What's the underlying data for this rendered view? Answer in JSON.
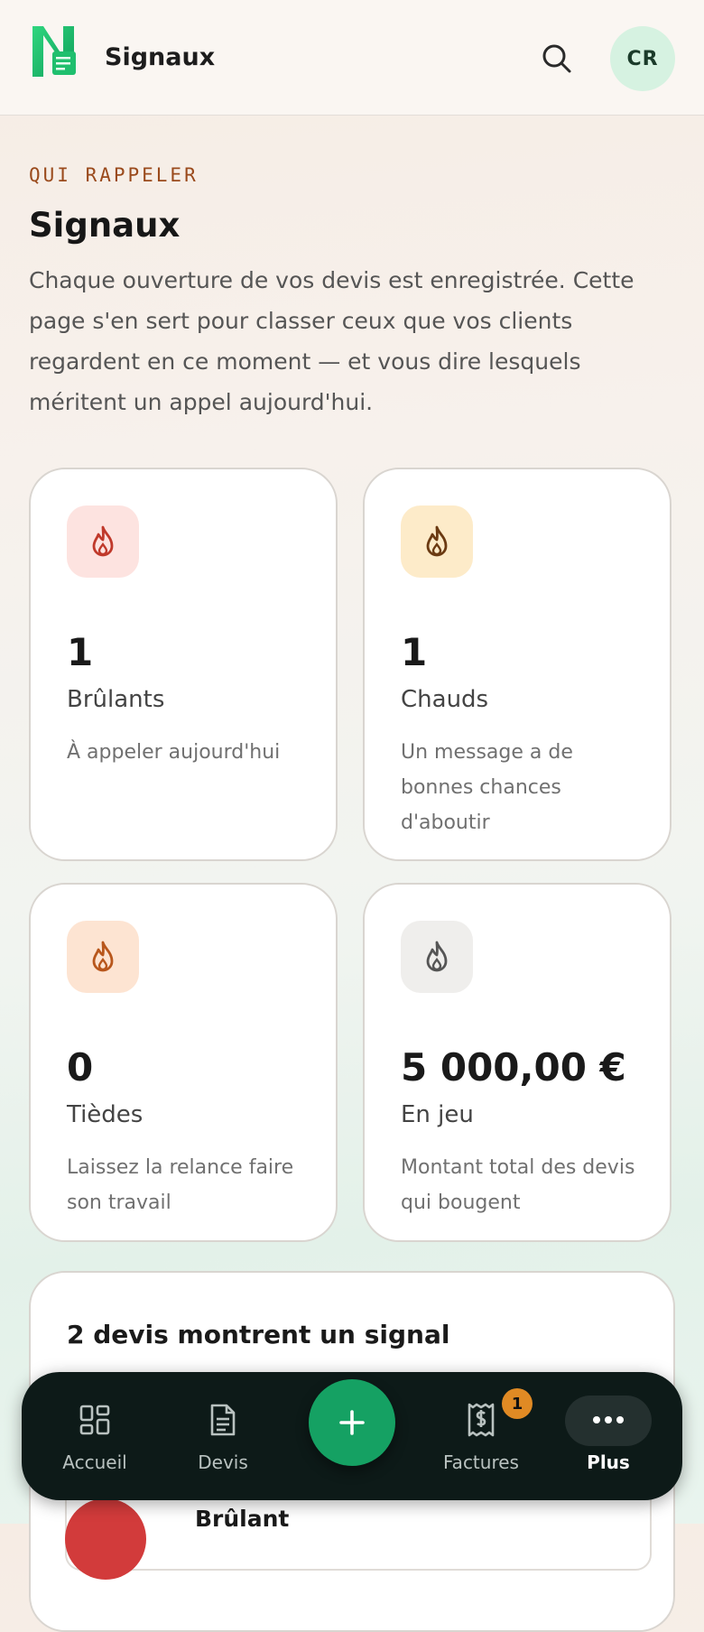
{
  "header": {
    "title": "Signaux",
    "avatar_initials": "CR"
  },
  "intro": {
    "eyebrow": "QUI RAPPELER",
    "title": "Signaux",
    "text": "Chaque ouverture de vos devis est enregistrée. Cette page s'en sert pour classer ceux que vos clients regardent en ce moment — et vous dire lesquels méritent un appel aujourd'hui."
  },
  "stats": [
    {
      "value": "1",
      "label": "Brûlants",
      "description": "À appeler aujourd'hui",
      "icon": "flame-icon",
      "color": "#c0392b",
      "bg": "#fde3e0"
    },
    {
      "value": "1",
      "label": "Chauds",
      "description": "Un message a de bonnes chances d'aboutir",
      "icon": "flame-icon",
      "color": "#6b3a12",
      "bg": "#fdebc9"
    },
    {
      "value": "0",
      "label": "Tièdes",
      "description": "Laissez la relance faire son travail",
      "icon": "flame-icon",
      "color": "#b8571c",
      "bg": "#fde4d2"
    },
    {
      "value": "5 000,00 €",
      "label": "En jeu",
      "description": "Montant total des devis qui bougent",
      "icon": "flame-icon",
      "color": "#555555",
      "bg": "#efeeec"
    }
  ],
  "signals": {
    "title": "2 devis montrent un signal",
    "first_row_label": "Brûlant"
  },
  "nav": {
    "items": [
      {
        "label": "Accueil",
        "icon": "grid-icon"
      },
      {
        "label": "Devis",
        "icon": "document-icon"
      },
      {
        "label": "Factures",
        "icon": "receipt-icon",
        "badge": "1"
      },
      {
        "label": "Plus",
        "icon": "more-icon"
      }
    ],
    "fab_icon": "plus-icon"
  },
  "colors": {
    "accent": "#15a163",
    "eyebrow": "#9a4a1c",
    "nav_bg": "#0d1a18",
    "badge": "#e08a24"
  }
}
